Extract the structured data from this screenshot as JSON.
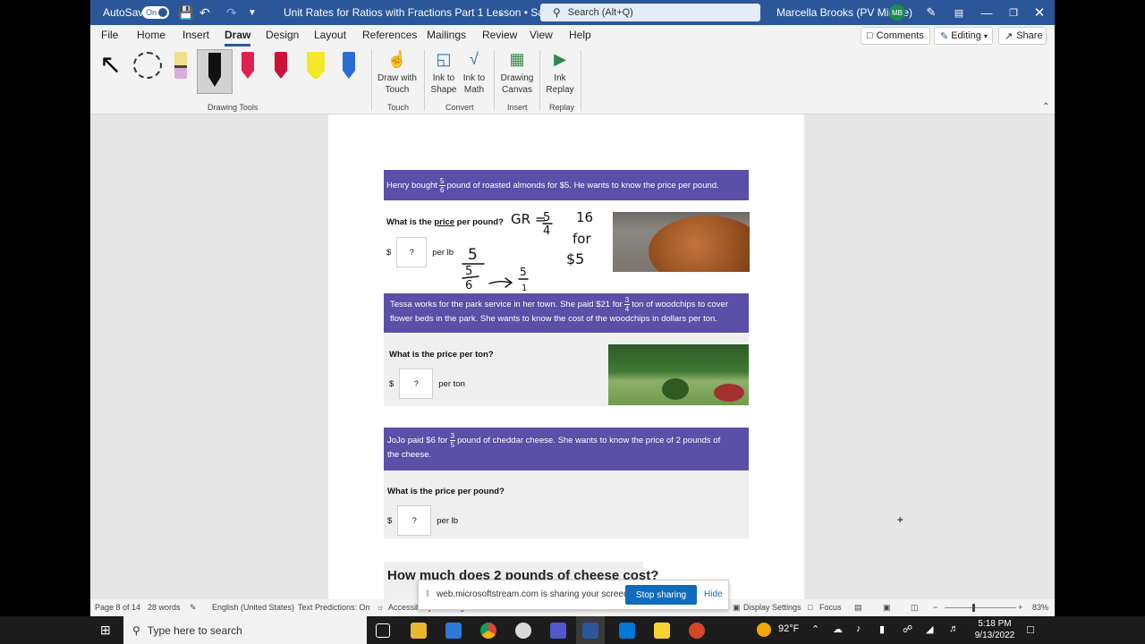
{
  "titlebar": {
    "autosave_label": "AutoSave",
    "autosave_state": "On",
    "doc_title": "Unit Rates for Ratios with Fractions Part 1 Lesson • Saving...",
    "search_placeholder": "Search (Alt+Q)",
    "user_name": "Marcella Brooks (PV Middle)",
    "user_initials": "MB"
  },
  "menu": {
    "tabs": [
      "File",
      "Home",
      "Insert",
      "Draw",
      "Design",
      "Layout",
      "References",
      "Mailings",
      "Review",
      "View",
      "Help"
    ],
    "active_tab": "Draw",
    "comments_label": "Comments",
    "editing_label": "Editing",
    "share_label": "Share"
  },
  "ribbon": {
    "draw_with_touch": "Draw with Touch",
    "ink_to_shape": "Ink to Shape",
    "ink_to_math": "Ink to Math",
    "drawing_canvas": "Drawing Canvas",
    "ink_replay": "Ink Replay",
    "groups": [
      "Drawing Tools",
      "Touch",
      "Convert",
      "Insert",
      "Replay"
    ]
  },
  "problems": {
    "p1": {
      "pre": "Henry bought",
      "frac_num": "5",
      "frac_den": "6",
      "post": "pound of roasted almonds for $5. He wants to know the price per pound.",
      "question_pre": "What is the",
      "question_word": "price",
      "question_post": "per pound?",
      "currency": "$",
      "answer": "?",
      "unit": "per lb"
    },
    "p2": {
      "pre": "Tessa works for the park service in her town. She paid $21 for",
      "frac_num": "3",
      "frac_den": "4",
      "post": "ton of woodchips to cover",
      "line2": "flower beds in the park. She wants to know the cost of the woodchips in dollars per ton.",
      "question": "What is the price per ton?",
      "currency": "$",
      "answer": "?",
      "unit": "per ton"
    },
    "p3": {
      "pre": "JoJo paid $6 for",
      "frac_num": "3",
      "frac_den": "5",
      "post": "pound of cheddar cheese. She wants to know the price of 2 pounds of",
      "line2": "the cheese.",
      "question": "What is the price per pound?",
      "currency": "$",
      "answer": "?",
      "unit": "per lb"
    },
    "heading": "How much does 2 pounds of cheese cost?"
  },
  "ink": {
    "gr": "GR =",
    "gr_num": "5",
    "gr_den": "4",
    "sixteen": "16",
    "for": "for",
    "five_dollars": "$5",
    "work_top": "5",
    "work_mid": "5",
    "work_bot": "6",
    "result_num": "5",
    "result_den": "1"
  },
  "status": {
    "page": "Page 8 of 14",
    "words": "28 words",
    "language": "English (United States)",
    "predictions": "Text Predictions: On",
    "accessibility": "Accessibility: Investigate",
    "display_settings": "Display Settings",
    "focus": "Focus",
    "zoom": "83%"
  },
  "share_notice": {
    "message": "web.microsoftstream.com is sharing your screen.",
    "stop_label": "Stop sharing",
    "hide_label": "Hide"
  },
  "taskbar": {
    "search_placeholder": "Type here to search",
    "weather": "92°F",
    "time": "5:18 PM",
    "date": "9/13/2022"
  },
  "colors": {
    "word_blue": "#2b579a",
    "banner_purple": "#5b4fa8",
    "stop_button": "#0f6cbd"
  }
}
